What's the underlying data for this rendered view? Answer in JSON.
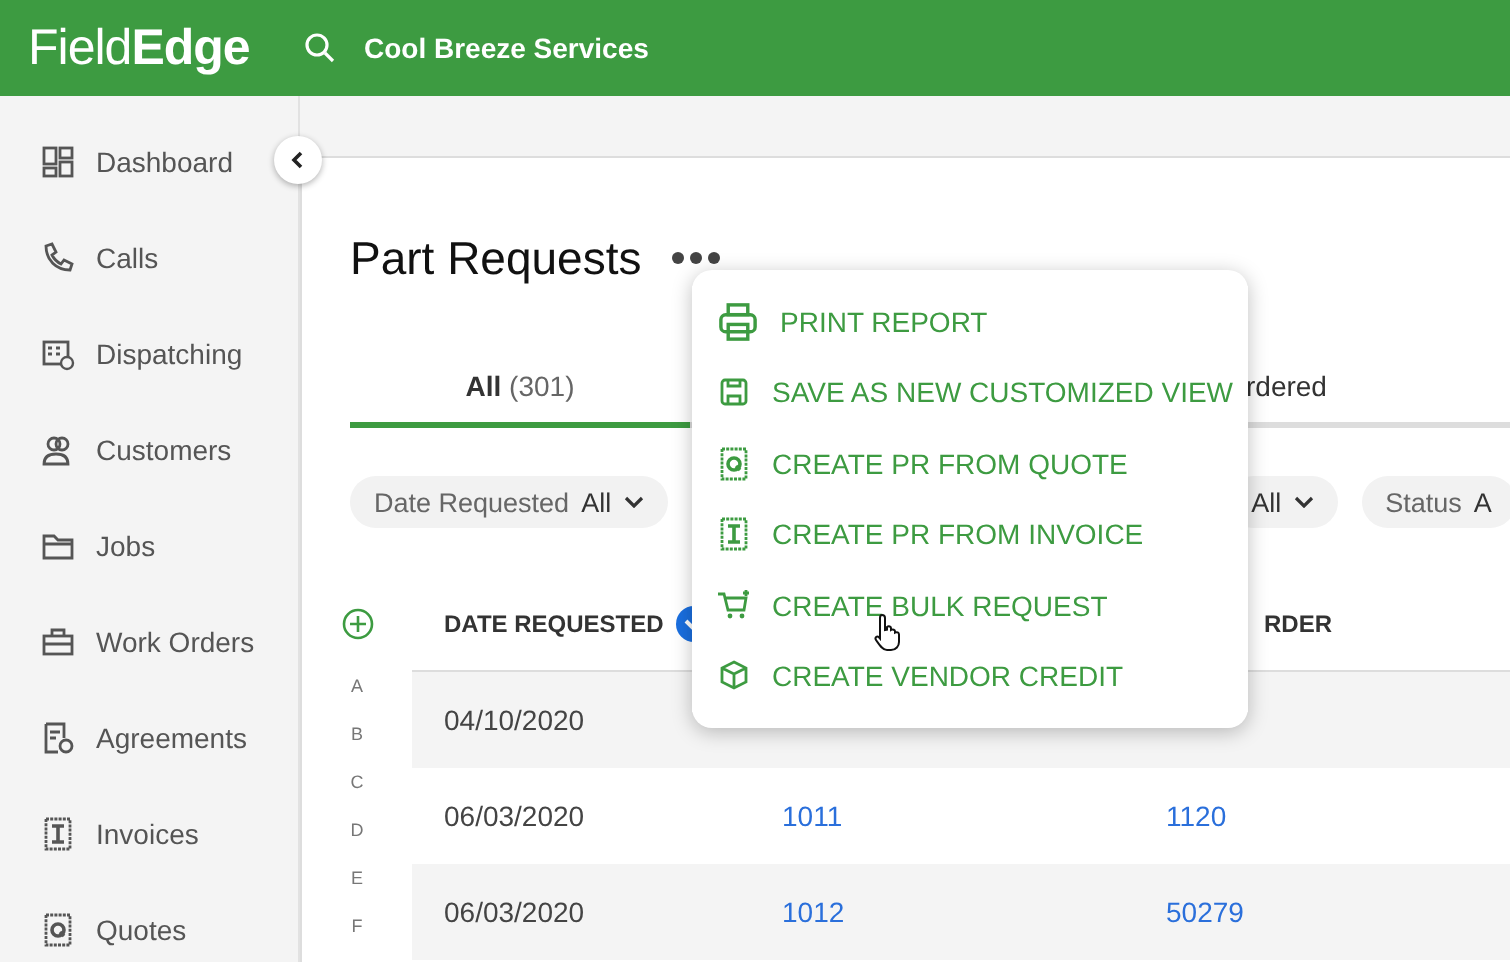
{
  "header": {
    "logo_light": "Field",
    "logo_bold": "Edge",
    "company": "Cool Breeze Services"
  },
  "sidebar": {
    "items": [
      {
        "label": "Dashboard"
      },
      {
        "label": "Calls"
      },
      {
        "label": "Dispatching"
      },
      {
        "label": "Customers"
      },
      {
        "label": "Jobs"
      },
      {
        "label": "Work Orders"
      },
      {
        "label": "Agreements"
      },
      {
        "label": "Invoices"
      },
      {
        "label": "Quotes"
      }
    ]
  },
  "page": {
    "title": "Part Requests"
  },
  "tabs": [
    {
      "label": "All",
      "count": "(301)",
      "selected": true
    },
    {
      "label": "rdered",
      "selected": false
    }
  ],
  "filters": [
    {
      "label": "Date Requested",
      "value": "All"
    },
    {
      "value": "All"
    },
    {
      "label": "Status",
      "value": "A"
    }
  ],
  "index_letters": [
    "A",
    "B",
    "C",
    "D",
    "E",
    "F"
  ],
  "table": {
    "columns": [
      "DATE REQUESTED",
      "",
      "RDER"
    ],
    "rows": [
      {
        "cells": [
          "04/10/2020",
          "",
          ""
        ]
      },
      {
        "cells": [
          "06/03/2020",
          "1011",
          "1120"
        ]
      },
      {
        "cells": [
          "06/03/2020",
          "1012",
          "50279"
        ]
      }
    ]
  },
  "menu": {
    "items": [
      {
        "label": "PRINT REPORT"
      },
      {
        "label": "SAVE AS NEW CUSTOMIZED VIEW"
      },
      {
        "label": "CREATE PR FROM QUOTE"
      },
      {
        "label": "CREATE PR FROM INVOICE"
      },
      {
        "label": "CREATE BULK REQUEST"
      },
      {
        "label": "CREATE VENDOR CREDIT"
      }
    ]
  }
}
